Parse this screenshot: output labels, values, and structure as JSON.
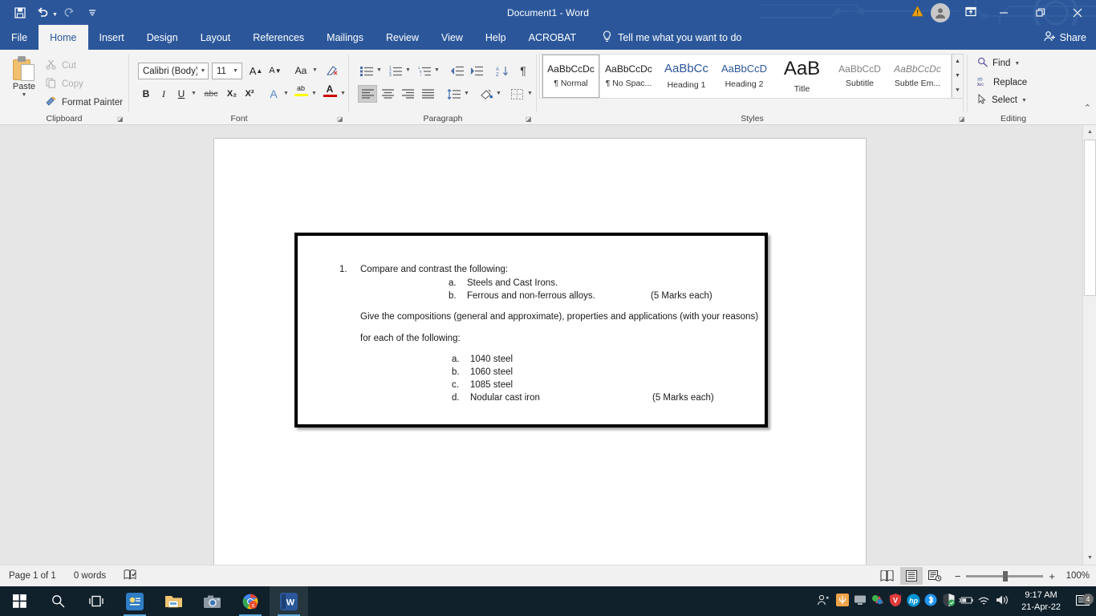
{
  "titlebar": {
    "title": "Document1  -  Word",
    "quick_access": [
      {
        "name": "save",
        "glyph": "⬜",
        "label": "Save"
      },
      {
        "name": "undo",
        "glyph": "↶",
        "label": "Undo"
      },
      {
        "name": "redo",
        "glyph": "↻",
        "label": "Redo"
      },
      {
        "name": "customize-quick-access-toolbar",
        "glyph": "≡",
        "label": "Customize Quick Access Toolbar"
      }
    ],
    "warning_icon": "⚠",
    "account_icon": "👤",
    "ribbon_display_options": "⬚",
    "minimize": "—",
    "restore": "❐",
    "close": "✕"
  },
  "tabs": [
    {
      "label": "File",
      "active": false
    },
    {
      "label": "Home",
      "active": true
    },
    {
      "label": "Insert",
      "active": false
    },
    {
      "label": "Design",
      "active": false
    },
    {
      "label": "Layout",
      "active": false
    },
    {
      "label": "References",
      "active": false
    },
    {
      "label": "Mailings",
      "active": false
    },
    {
      "label": "Review",
      "active": false
    },
    {
      "label": "View",
      "active": false
    },
    {
      "label": "Help",
      "active": false
    },
    {
      "label": "ACROBAT",
      "active": false
    }
  ],
  "tellme": {
    "placeholder": "Tell me what you want to do",
    "icon": "💡"
  },
  "share": {
    "label": "Share",
    "icon": "👤"
  },
  "ribbon": {
    "clipboard": {
      "group_label": "Clipboard",
      "paste_label": "Paste",
      "items": [
        {
          "label": "Cut",
          "icon": "✂",
          "disabled": true
        },
        {
          "label": "Copy",
          "icon": "⧉",
          "disabled": true
        },
        {
          "label": "Format Painter",
          "icon": "🖌",
          "disabled": false
        }
      ]
    },
    "font": {
      "group_label": "Font",
      "font_name": "Calibri (Body)",
      "font_size": "11",
      "grow_font": "A",
      "shrink_font": "A",
      "change_case": "Aa",
      "clear_formatting": "✐",
      "bold": "B",
      "italic": "I",
      "underline": "U",
      "strikethrough": "abc",
      "subscript": "X₂",
      "superscript": "X²",
      "text_effects": "A",
      "highlight": "ab",
      "font_color": "A"
    },
    "paragraph": {
      "group_label": "Paragraph",
      "bullets": "☰",
      "numbering": "☷",
      "multilevel": "☵",
      "decrease_indent": "⇤",
      "increase_indent": "⇥",
      "sort": "A↓",
      "show_marks": "¶",
      "align_left": "☰",
      "align_center": "☰",
      "align_right": "☰",
      "justify": "☰",
      "line_spacing": "↕",
      "shading": "◆",
      "borders": "▦"
    },
    "styles": {
      "group_label": "Styles",
      "items": [
        {
          "preview": "AaBbCcDc",
          "name": "¶ Normal",
          "active": true,
          "color": "black"
        },
        {
          "preview": "AaBbCcDc",
          "name": "¶ No Spac...",
          "active": false,
          "color": "black"
        },
        {
          "preview": "AaBbCc",
          "name": "Heading 1",
          "active": false,
          "color": "blue"
        },
        {
          "preview": "AaBbCcD",
          "name": "Heading 2",
          "active": false,
          "color": "blue"
        },
        {
          "preview": "AaB",
          "name": "Title",
          "active": false,
          "color": "black"
        },
        {
          "preview": "AaBbCcD",
          "name": "Subtitle",
          "active": false,
          "color": "gray"
        },
        {
          "preview": "AaBbCcDc",
          "name": "Subtle Em...",
          "active": false,
          "color": "gray"
        }
      ],
      "scroll_up": "▲",
      "scroll_down": "▼",
      "more": "≡"
    },
    "editing": {
      "group_label": "Editing",
      "items": [
        {
          "label": "Find",
          "icon": "🔍",
          "caret": true
        },
        {
          "label": "Replace",
          "icon": "ab",
          "caret": false
        },
        {
          "label": "Select",
          "icon": "↖",
          "caret": true
        }
      ]
    },
    "collapse_icon": "⌃"
  },
  "document": {
    "question_number": "1.",
    "intro": "Compare and contrast the following:",
    "sub_items_1": [
      {
        "marker": "a.",
        "text": "Steels and Cast Irons.",
        "marks": ""
      },
      {
        "marker": "b.",
        "text": "Ferrous and non-ferrous alloys.",
        "marks": "(5 Marks each)"
      }
    ],
    "para_line_1": "Give the compositions (general and approximate), properties and applications (with your reasons)",
    "para_line_2": "for each of the following:",
    "sub_items_2": [
      {
        "marker": "a.",
        "text": "1040 steel",
        "marks": ""
      },
      {
        "marker": "b.",
        "text": "1060 steel",
        "marks": ""
      },
      {
        "marker": "c.",
        "text": "1085 steel",
        "marks": ""
      },
      {
        "marker": "d.",
        "text": "Nodular cast iron",
        "marks": "(5 Marks each)"
      }
    ]
  },
  "statusbar": {
    "page": "Page 1 of 1",
    "words": "0 words",
    "proofing_icon": "📖",
    "views": [
      {
        "name": "read-mode",
        "icon": "📖",
        "active": false
      },
      {
        "name": "print-layout",
        "icon": "▤",
        "active": true
      },
      {
        "name": "web-layout",
        "icon": "▥",
        "active": false
      }
    ],
    "zoom_out": "−",
    "zoom_in": "+",
    "zoom_level": "100%"
  },
  "taskbar": {
    "items": [
      {
        "name": "start",
        "glyph": "⊞",
        "color": "#ffffff",
        "bg": "",
        "active": false,
        "running": false
      },
      {
        "name": "search",
        "glyph": "🔍",
        "color": "#ffffff",
        "bg": "",
        "active": false,
        "running": false
      },
      {
        "name": "task-view",
        "glyph": "⌸",
        "color": "#ffffff",
        "bg": "",
        "active": false,
        "running": false
      },
      {
        "name": "powerpoint",
        "glyph": "P",
        "color": "#ffffff",
        "bg": "#3a7bbf",
        "active": false,
        "running": true
      },
      {
        "name": "file-explorer",
        "glyph": "🗀",
        "color": "#e8c36a",
        "bg": "",
        "active": false,
        "running": false
      },
      {
        "name": "camera",
        "glyph": "📷",
        "color": "#9aa4ad",
        "bg": "",
        "active": false,
        "running": false
      },
      {
        "name": "chrome",
        "glyph": "◉",
        "color": "#e8453c",
        "bg": "",
        "active": false,
        "running": true
      },
      {
        "name": "word",
        "glyph": "W",
        "color": "#ffffff",
        "bg": "#2b579a",
        "active": true,
        "running": true
      }
    ],
    "tray": [
      {
        "name": "people",
        "glyph": "👤"
      },
      {
        "name": "app-orange",
        "glyph": "▣"
      },
      {
        "name": "display",
        "glyph": "🖥"
      },
      {
        "name": "adobe",
        "glyph": "▲"
      },
      {
        "name": "antivirus",
        "glyph": "🛡"
      },
      {
        "name": "hp",
        "glyph": "hp"
      },
      {
        "name": "bluetooth",
        "glyph": "ᛦ"
      },
      {
        "name": "security",
        "glyph": "🛡"
      },
      {
        "name": "battery",
        "glyph": "🔋"
      },
      {
        "name": "wifi",
        "glyph": "◠"
      },
      {
        "name": "volume",
        "glyph": "🔊"
      }
    ],
    "time": "9:17 AM",
    "date": "21-Apr-22",
    "notification_icon": "💬",
    "notification_count": "4"
  }
}
